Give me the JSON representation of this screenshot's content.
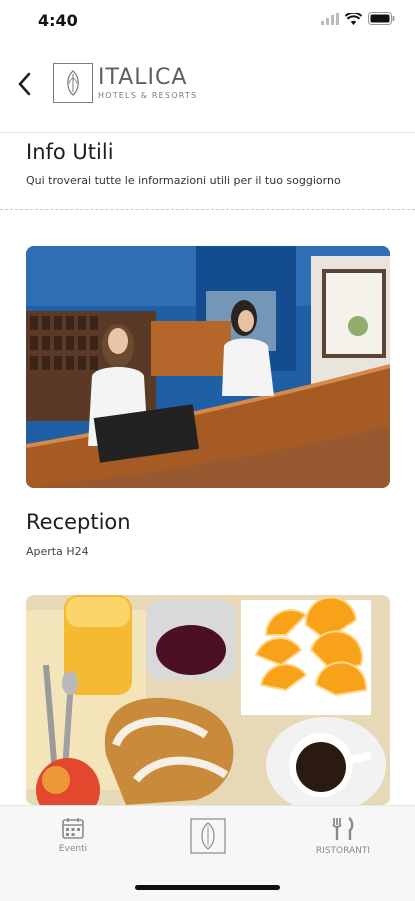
{
  "status_bar": {
    "time": "4:40"
  },
  "header": {
    "brand_name": "ITALICA",
    "brand_tagline": "HOTELS & RESORTS"
  },
  "section": {
    "title": "Info Utili",
    "subtitle": "Qui troverai tutte le informazioni utili per il tuo soggiorno"
  },
  "cards": [
    {
      "title": "Reception",
      "subtitle": "Aperta H24"
    }
  ],
  "tab_bar": {
    "tabs": [
      {
        "label": "Eventi",
        "icon": "calendar-icon"
      },
      {
        "label": "",
        "icon": "brand-logo-icon"
      },
      {
        "label": "RISTORANTI",
        "icon": "fork-knife-icon"
      }
    ]
  },
  "colors": {
    "background": "#ffffff",
    "tab_bar": "#f7f7f7",
    "tab_label": "#8a8a8a",
    "brand": "#5f5f5f"
  }
}
